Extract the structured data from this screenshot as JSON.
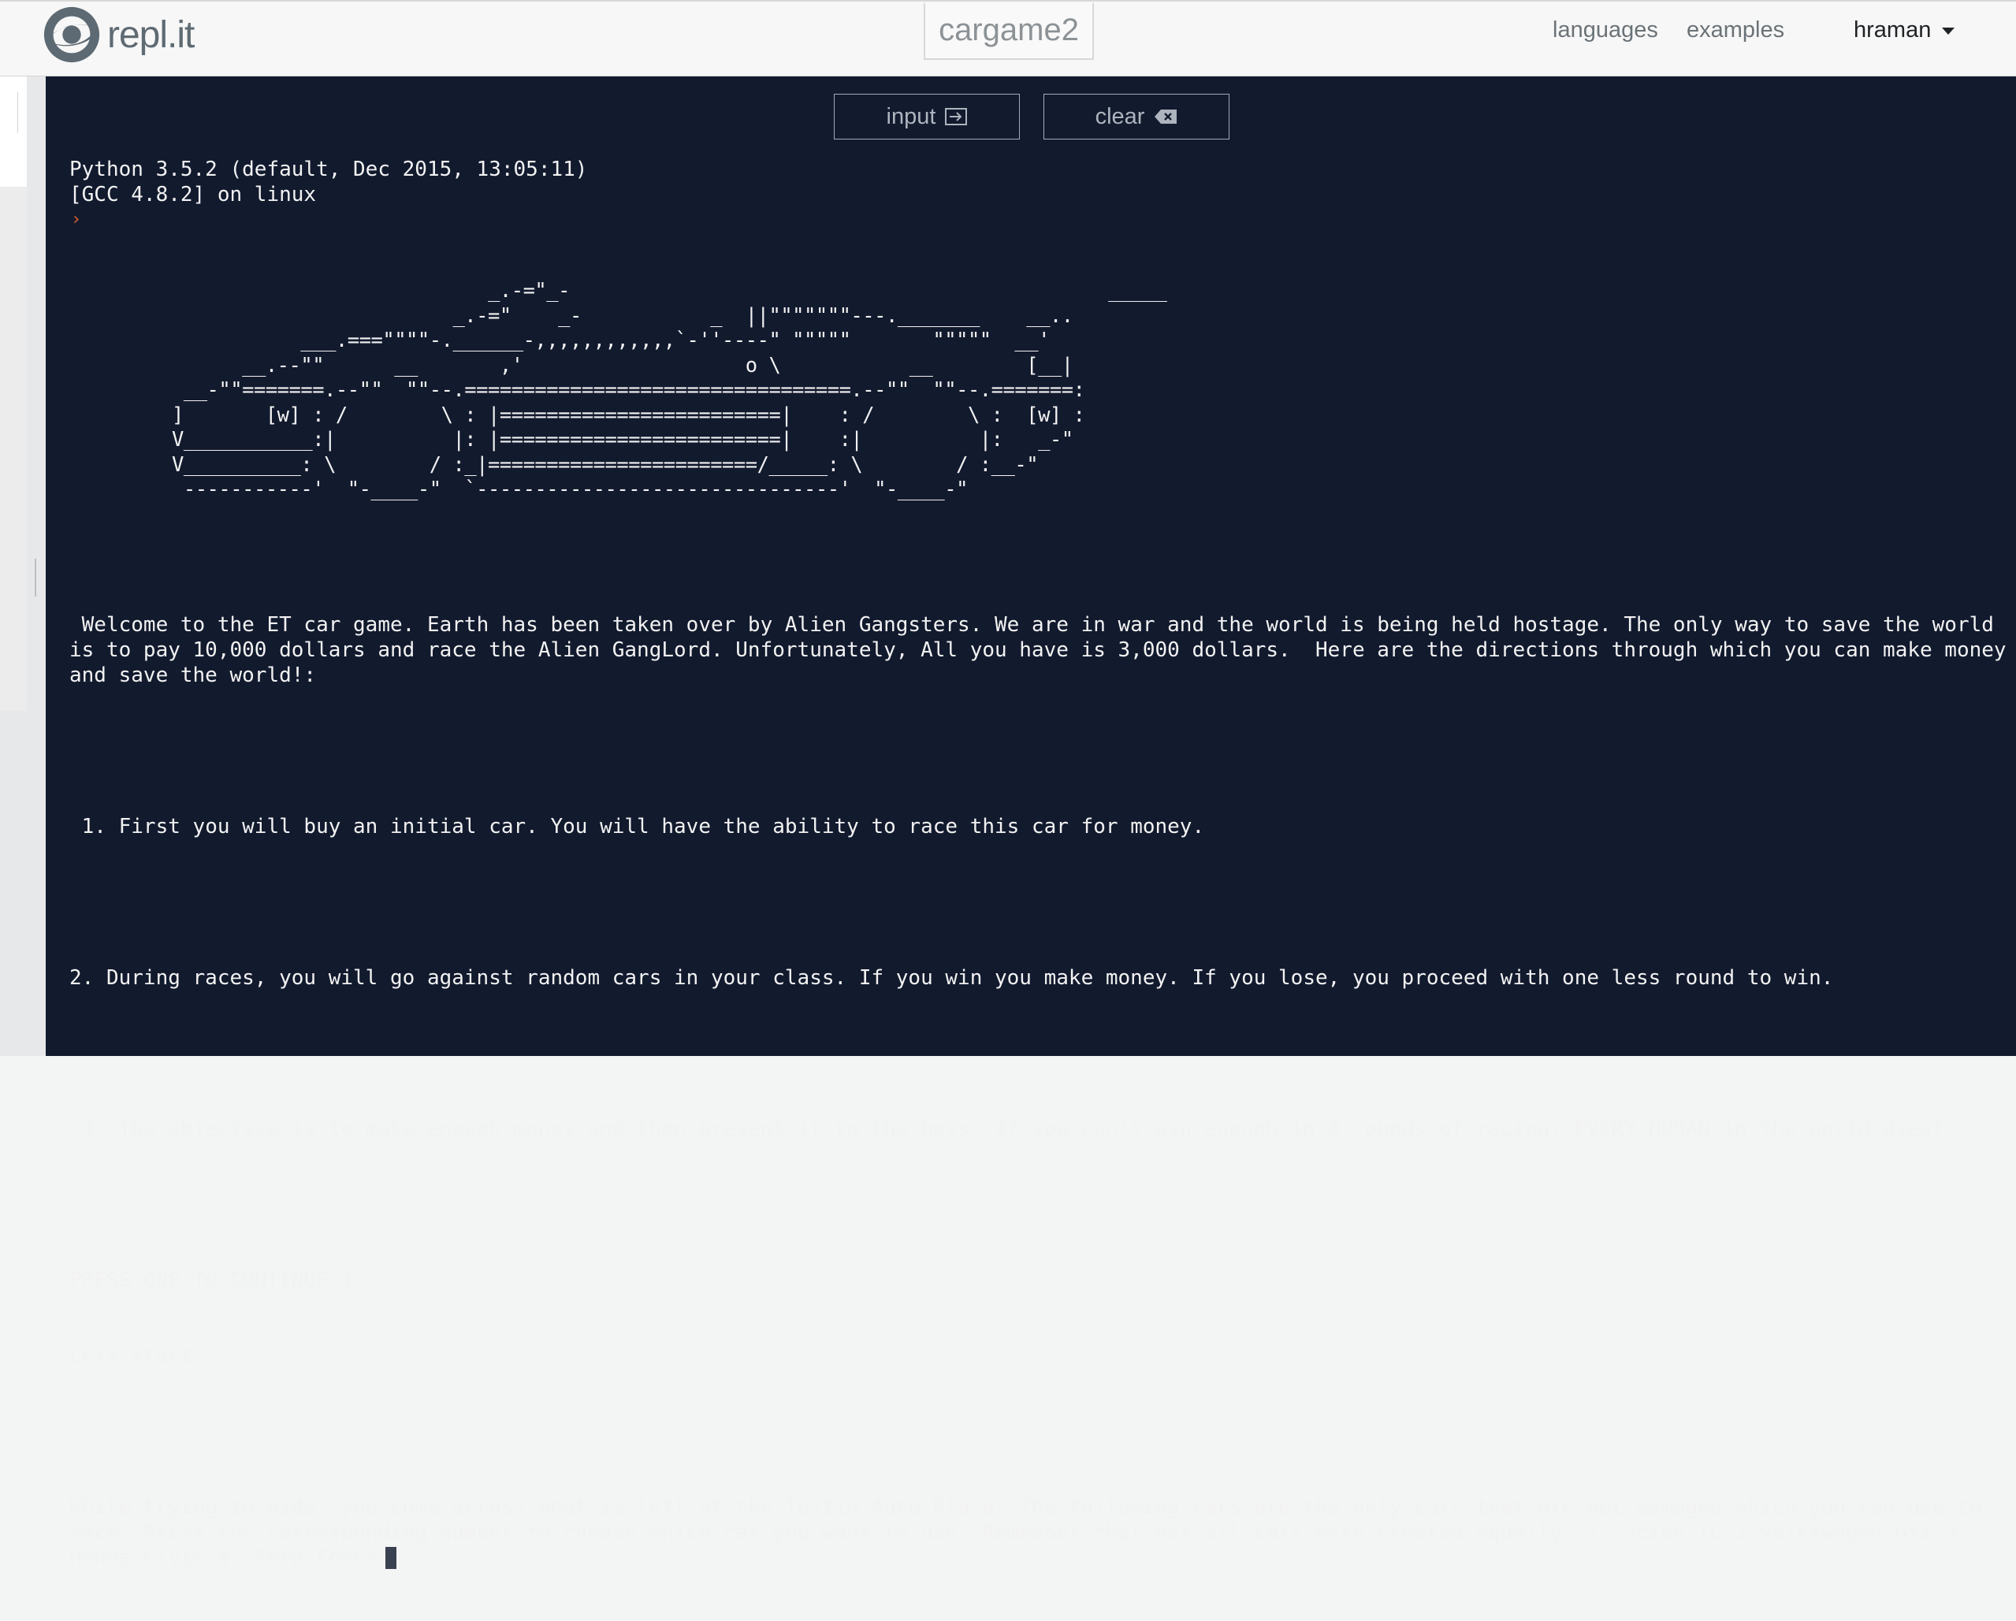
{
  "header": {
    "logo_text": "repl.it",
    "project_name": "cargame2",
    "nav_languages": "languages",
    "nav_examples": "examples",
    "user_name": "hraman"
  },
  "toolbar": {
    "input_label": "input",
    "clear_label": "clear"
  },
  "console": {
    "version_line": "Python 3.5.2 (default, Dec 2015, 13:05:11)",
    "gcc_line": "[GCC 4.8.2] on linux",
    "prompt_symbol": "›",
    "ascii_car": "                           _.-=\"_-                                              _____\n                        _.-=\"    _-           _  ||\"\"\"\"\"\"\"---._______    __..\n           ___.===\"\"\"\"-.______-,,,,,,,,,,,,`-''----\" \"\"\"\"\"       \"\"\"\"\"  __'\n      __.--\"\"      __       ,'                   o \\           __        [__|\n __-\"\"=======.--\"\"  \"\"--.=================================.--\"\"  \"\"--.=======:\n]       [w] : /        \\ : |========================|    : /        \\ :  [w] :\nV___________:|          |: |========================|    :|          |:   _-\"\nV__________: \\        / :_|=======================/_____: \\        / :__-\"\n -----------'  \"-____-\"  `-------------------------------'  \"-____-\"",
    "welcome_text": " Welcome to the ET car game. Earth has been taken over by Alien Gangsters. We are in war and the world is being held hostage. The only way to save the world is to pay 10,000 dollars and race the Alien GangLord. Unfortunately, All you have is 3,000 dollars.  Here are the directions through which you can make money and save the world!:",
    "step1": " 1. First you will buy an initial car. You will have the ability to race this car for money.",
    "step2": "2. During races, you will go against random cars in your class. If you win you make money. If you lose, you proceed with one less round to win.",
    "step3": " 3. The objective is to make enough money and then present it to the boss. If you can't win enough in 4 rounds of racing, EVERY HUMAN in the world dies!",
    "press_line": "PRESS ONE TO CONTINUE 1",
    "lets_start": "Lets start",
    "choose_text": "While trying to hide, you come across what is left of the Tustin Auto Plaza. The following cars are the only cars that are not damaged which you can use to race. Press the corresponding number to choose which car you want to use. Remember that not all cars were created equally. 1. Scion TC 2.Volkswagen Gti 3. Honda Civic 4. Ford Focus"
  },
  "colors": {
    "console_bg": "#121a2e",
    "console_text": "#f2f2f2",
    "prompt": "#e0602f",
    "header_bg": "#f7f7f7"
  }
}
